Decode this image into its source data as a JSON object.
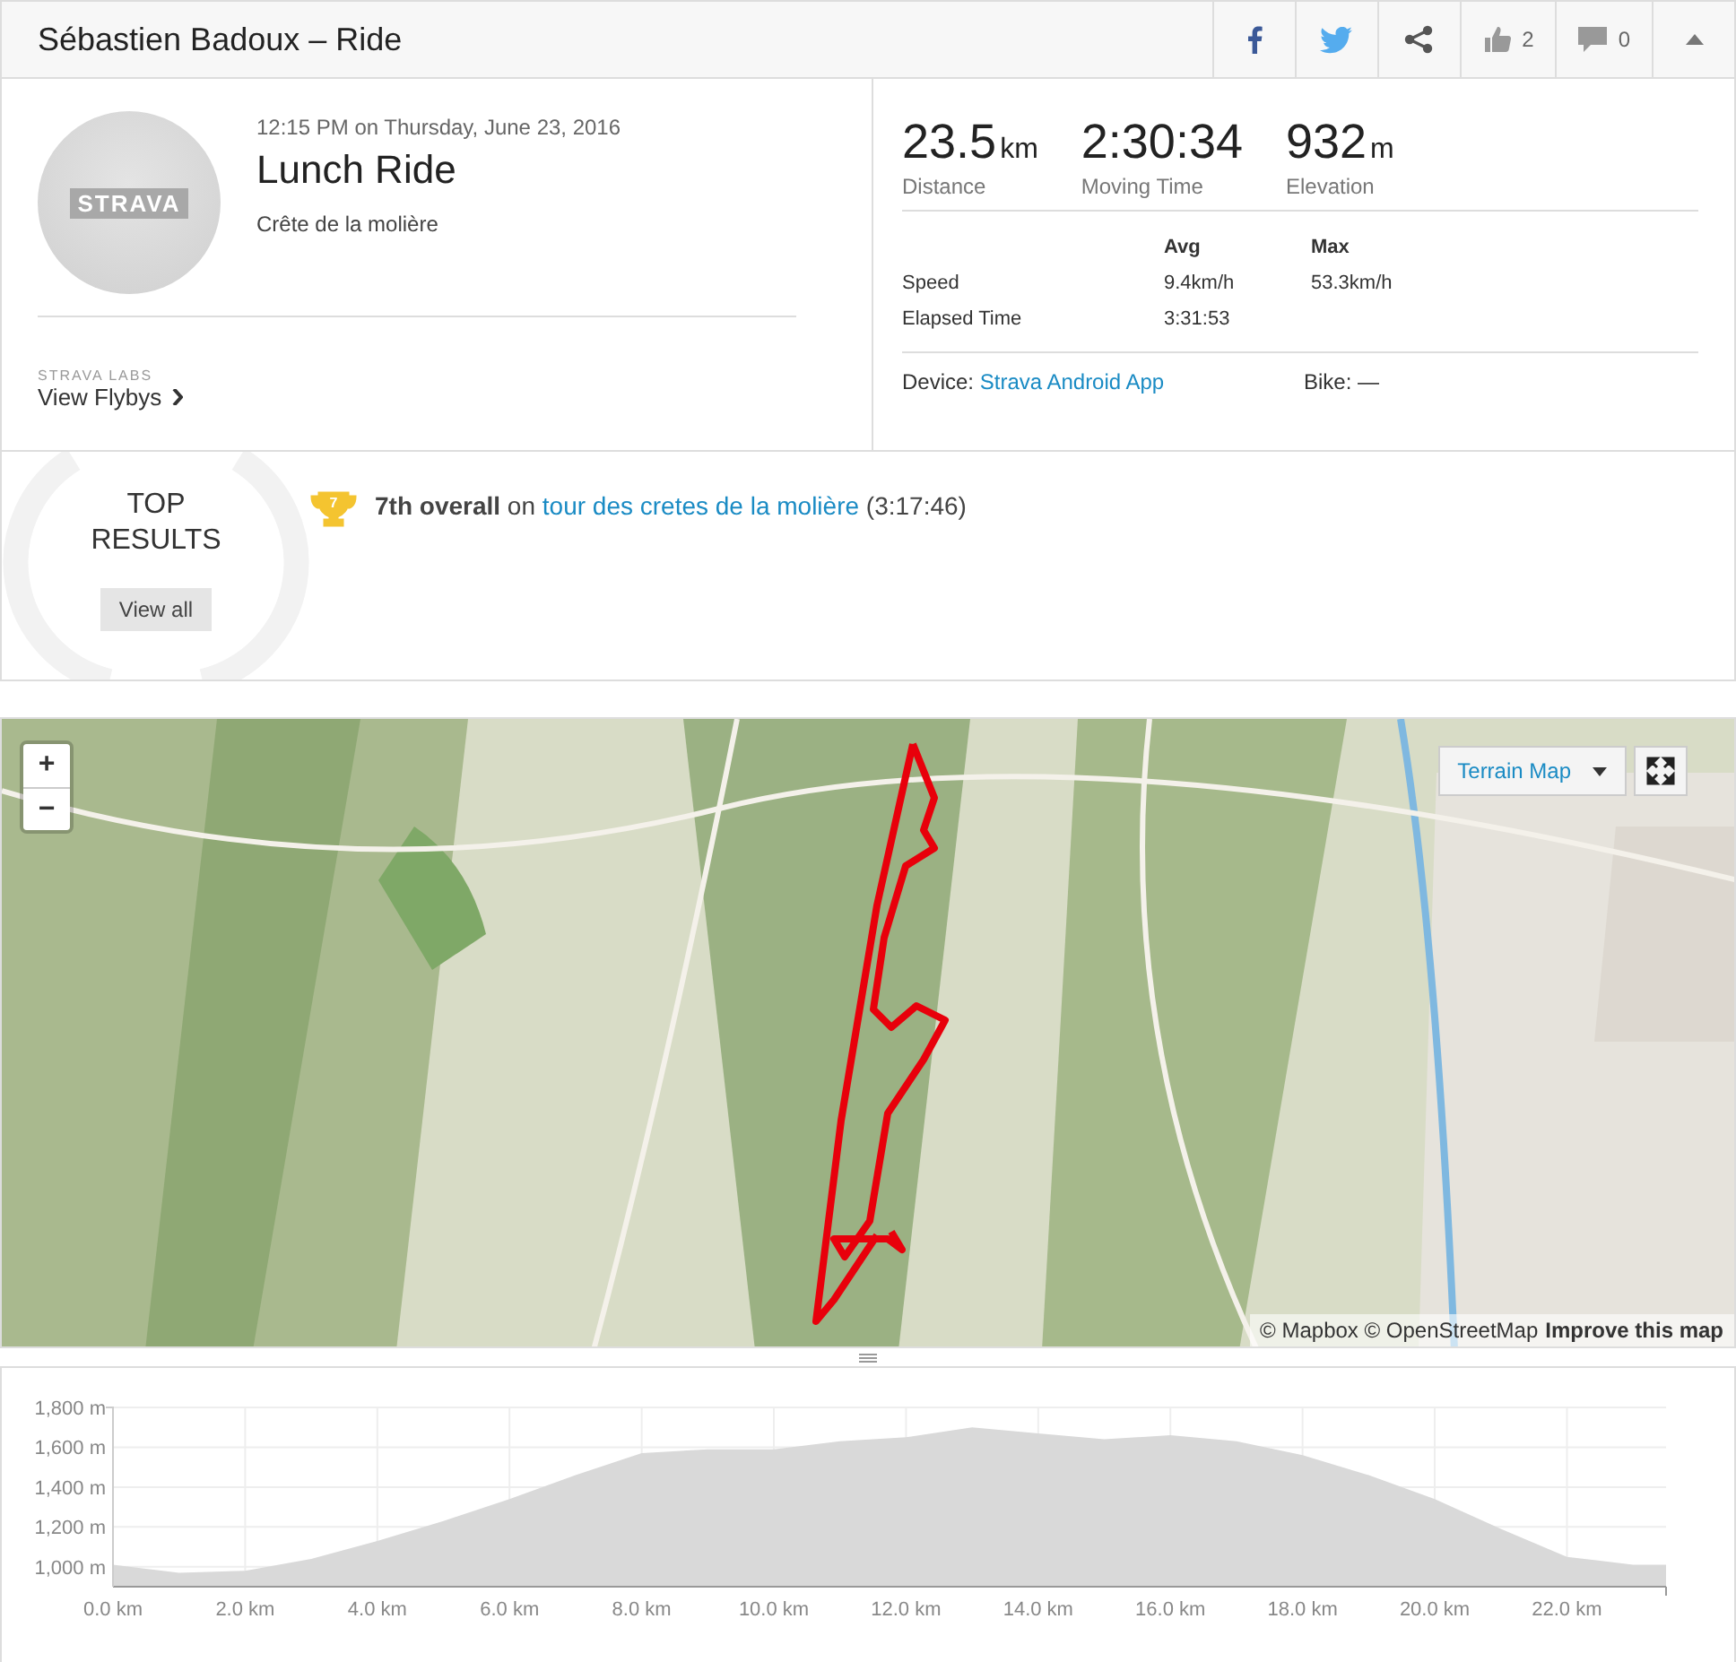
{
  "header": {
    "title": "Sébastien Badoux – Ride",
    "kudos": "2",
    "comments": "0"
  },
  "activity": {
    "avatar_text": "STRAVA",
    "datetime": "12:15 PM on Thursday, June 23, 2016",
    "name": "Lunch Ride",
    "description": "Crête de la molière",
    "labs_label": "STRAVA LABS",
    "flybys": "View Flybys"
  },
  "stats": [
    {
      "value": "23.5",
      "unit": "km",
      "label": "Distance"
    },
    {
      "value": "2:30:34",
      "label": "Moving Time"
    },
    {
      "value": "932",
      "unit": "m",
      "label": "Elevation"
    }
  ],
  "details": {
    "columns": [
      "Avg",
      "Max"
    ],
    "rows": [
      {
        "label": "Speed",
        "avg": "9.4km/h",
        "max": "53.3km/h"
      },
      {
        "label": "Elapsed Time",
        "avg": "3:31:53"
      }
    ]
  },
  "device": {
    "label": "Device:",
    "value": "Strava Android App",
    "bike_label": "Bike:",
    "bike_value": "—"
  },
  "top_results": {
    "title_line1": "TOP",
    "title_line2": "RESULTS",
    "button": "View all",
    "achievements": [
      {
        "rank": "7",
        "place": "7th overall",
        "on": "on",
        "segment": "tour des cretes de la molière",
        "time": "(3:17:46)"
      }
    ]
  },
  "map": {
    "zoom_in": "+",
    "zoom_out": "−",
    "map_type": "Terrain Map",
    "attribution": "© Mapbox © OpenStreetMap",
    "improve": "Improve this map"
  },
  "elevation": {
    "chart_data": {
      "type": "area",
      "x": [
        0,
        1,
        2,
        3,
        4,
        5,
        6,
        7,
        8,
        9,
        10,
        11,
        12,
        13,
        14,
        15,
        16,
        17,
        18,
        19,
        20,
        21,
        22,
        23,
        23.5
      ],
      "grid": true,
      "series": [
        {
          "color": "#d9d9d9",
          "values": [
            1010,
            970,
            980,
            1040,
            1130,
            1230,
            1340,
            1460,
            1570,
            1590,
            1590,
            1630,
            1650,
            1700,
            1670,
            1640,
            1660,
            1630,
            1560,
            1460,
            1340,
            1190,
            1050,
            1010,
            1010
          ]
        }
      ],
      "xlim": [
        0,
        23.5
      ],
      "ylim": [
        900,
        1800
      ],
      "xticks": [
        {
          "value": 0,
          "label": "0.0 km"
        },
        {
          "value": 2,
          "label": "2.0 km"
        },
        {
          "value": 4,
          "label": "4.0 km"
        },
        {
          "value": 6,
          "label": "6.0 km"
        },
        {
          "value": 8,
          "label": "8.0 km"
        },
        {
          "value": 10,
          "label": "10.0 km"
        },
        {
          "value": 12,
          "label": "12.0 km"
        },
        {
          "value": 14,
          "label": "14.0 km"
        },
        {
          "value": 16,
          "label": "16.0 km"
        },
        {
          "value": 18,
          "label": "18.0 km"
        },
        {
          "value": 20,
          "label": "20.0 km"
        },
        {
          "value": 22,
          "label": "22.0 km"
        }
      ],
      "yticks": [
        {
          "value": 1000,
          "label": "1,000 m"
        },
        {
          "value": 1200,
          "label": "1,200 m"
        },
        {
          "value": 1400,
          "label": "1,400 m"
        },
        {
          "value": 1600,
          "label": "1,600 m"
        },
        {
          "value": 1800,
          "label": "1,800 m"
        }
      ]
    }
  }
}
